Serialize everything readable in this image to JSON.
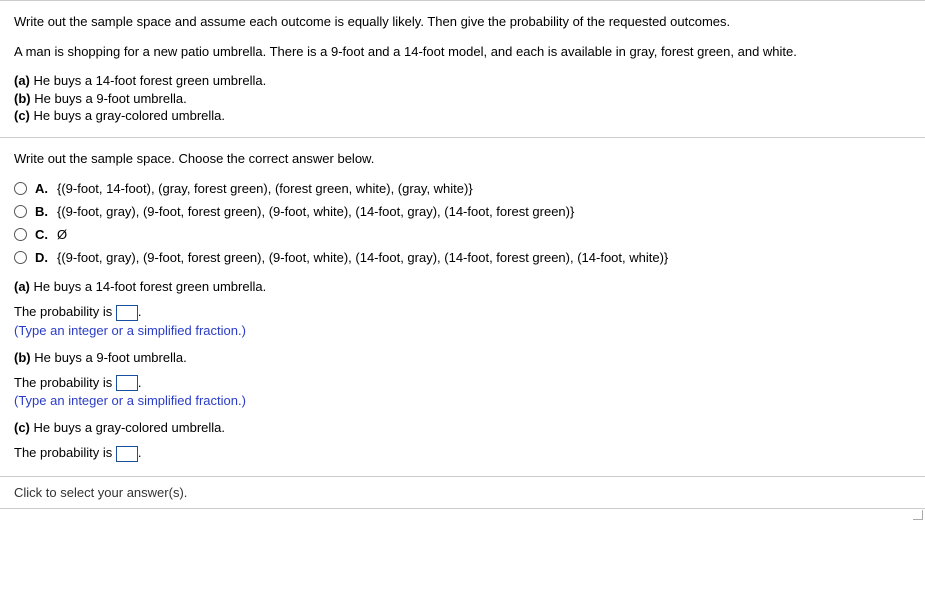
{
  "question": {
    "prompt": "Write out the sample space and assume each outcome is equally likely. Then give the probability of the requested outcomes.",
    "scenario": "A man is shopping for a new patio umbrella. There is a 9-foot and a 14-foot model, and each is available in gray, forest green, and white.",
    "subparts": {
      "a": "He buys a 14-foot forest green umbrella.",
      "b": "He buys a 9-foot umbrella.",
      "c": "He buys a gray-colored umbrella."
    }
  },
  "sample_space": {
    "instruction": "Write out the sample space. Choose the correct answer below.",
    "options": {
      "A": "{(9-foot, 14-foot), (gray, forest green), (forest green, white), (gray, white)}",
      "B": "{(9-foot, gray), (9-foot, forest green), (9-foot, white), (14-foot, gray), (14-foot, forest green)}",
      "C": "Ø",
      "D": "{(9-foot, gray), (9-foot, forest green), (9-foot, white), (14-foot, gray), (14-foot, forest green), (14-foot, white)}"
    }
  },
  "labels": {
    "a": "(a)",
    "b": "(b)",
    "c": "(c)",
    "A": "A.",
    "B": "B.",
    "C": "C.",
    "D": "D.",
    "prob_prefix": "The probability is ",
    "period": ".",
    "hint": "(Type an integer or a simplified fraction.)",
    "footer": "Click to select your answer(s)."
  }
}
